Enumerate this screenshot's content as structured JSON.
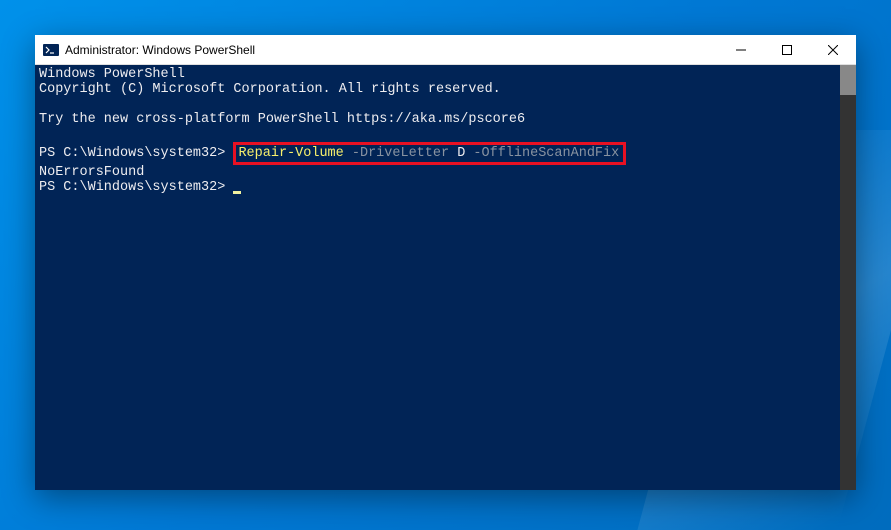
{
  "window": {
    "title": "Administrator: Windows PowerShell"
  },
  "terminal": {
    "line1": "Windows PowerShell",
    "line2": "Copyright (C) Microsoft Corporation. All rights reserved.",
    "line3": "Try the new cross-platform PowerShell https://aka.ms/pscore6",
    "prompt": "PS C:\\Windows\\system32> ",
    "cmd_name": "Repair-Volume",
    "cmd_param1": " -DriveLetter",
    "cmd_arg1": " D",
    "cmd_param2": " -OfflineScanAndFix",
    "result": "NoErrorsFound",
    "prompt2": "PS C:\\Windows\\system32> "
  },
  "colors": {
    "terminal_bg": "#012456",
    "highlight_border": "#e81123",
    "cmd_yellow": "#f9f06b",
    "cmd_gray": "#8892a0"
  }
}
